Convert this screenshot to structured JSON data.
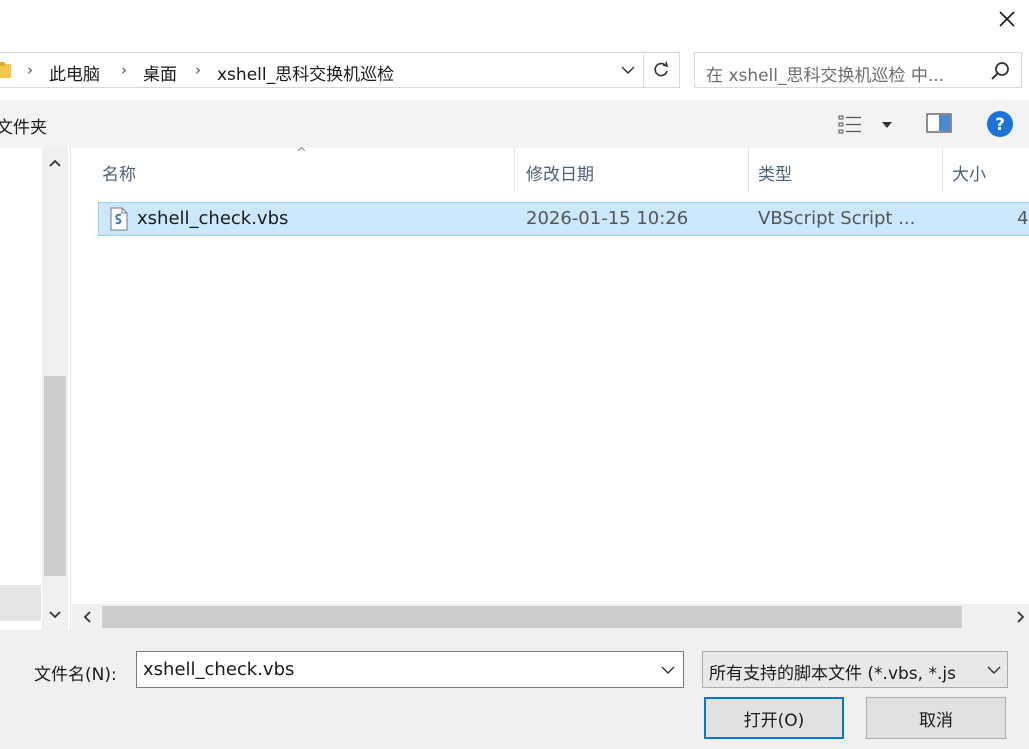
{
  "breadcrumb": {
    "items": [
      "此电脑",
      "桌面",
      "xshell_思科交换机巡检"
    ]
  },
  "search": {
    "placeholder": "在 xshell_思科交换机巡检 中..."
  },
  "toolbar": {
    "new_folder_label": "文件夹"
  },
  "columns": {
    "name": "名称",
    "modified": "修改日期",
    "type": "类型",
    "size": "大小"
  },
  "files": [
    {
      "name": "xshell_check.vbs",
      "modified": "2026-01-15 10:26",
      "type": "VBScript Script ...",
      "size": "4"
    }
  ],
  "bottom": {
    "filename_label": "文件名(N):",
    "filename_value": "xshell_check.vbs",
    "filter_value": "所有支持的脚本文件 (*.vbs, *.js",
    "open_label": "打开(O)",
    "cancel_label": "取消"
  },
  "colors": {
    "accent": "#0078d7",
    "selection": "#cce8ff",
    "help": "#1a73d9"
  }
}
